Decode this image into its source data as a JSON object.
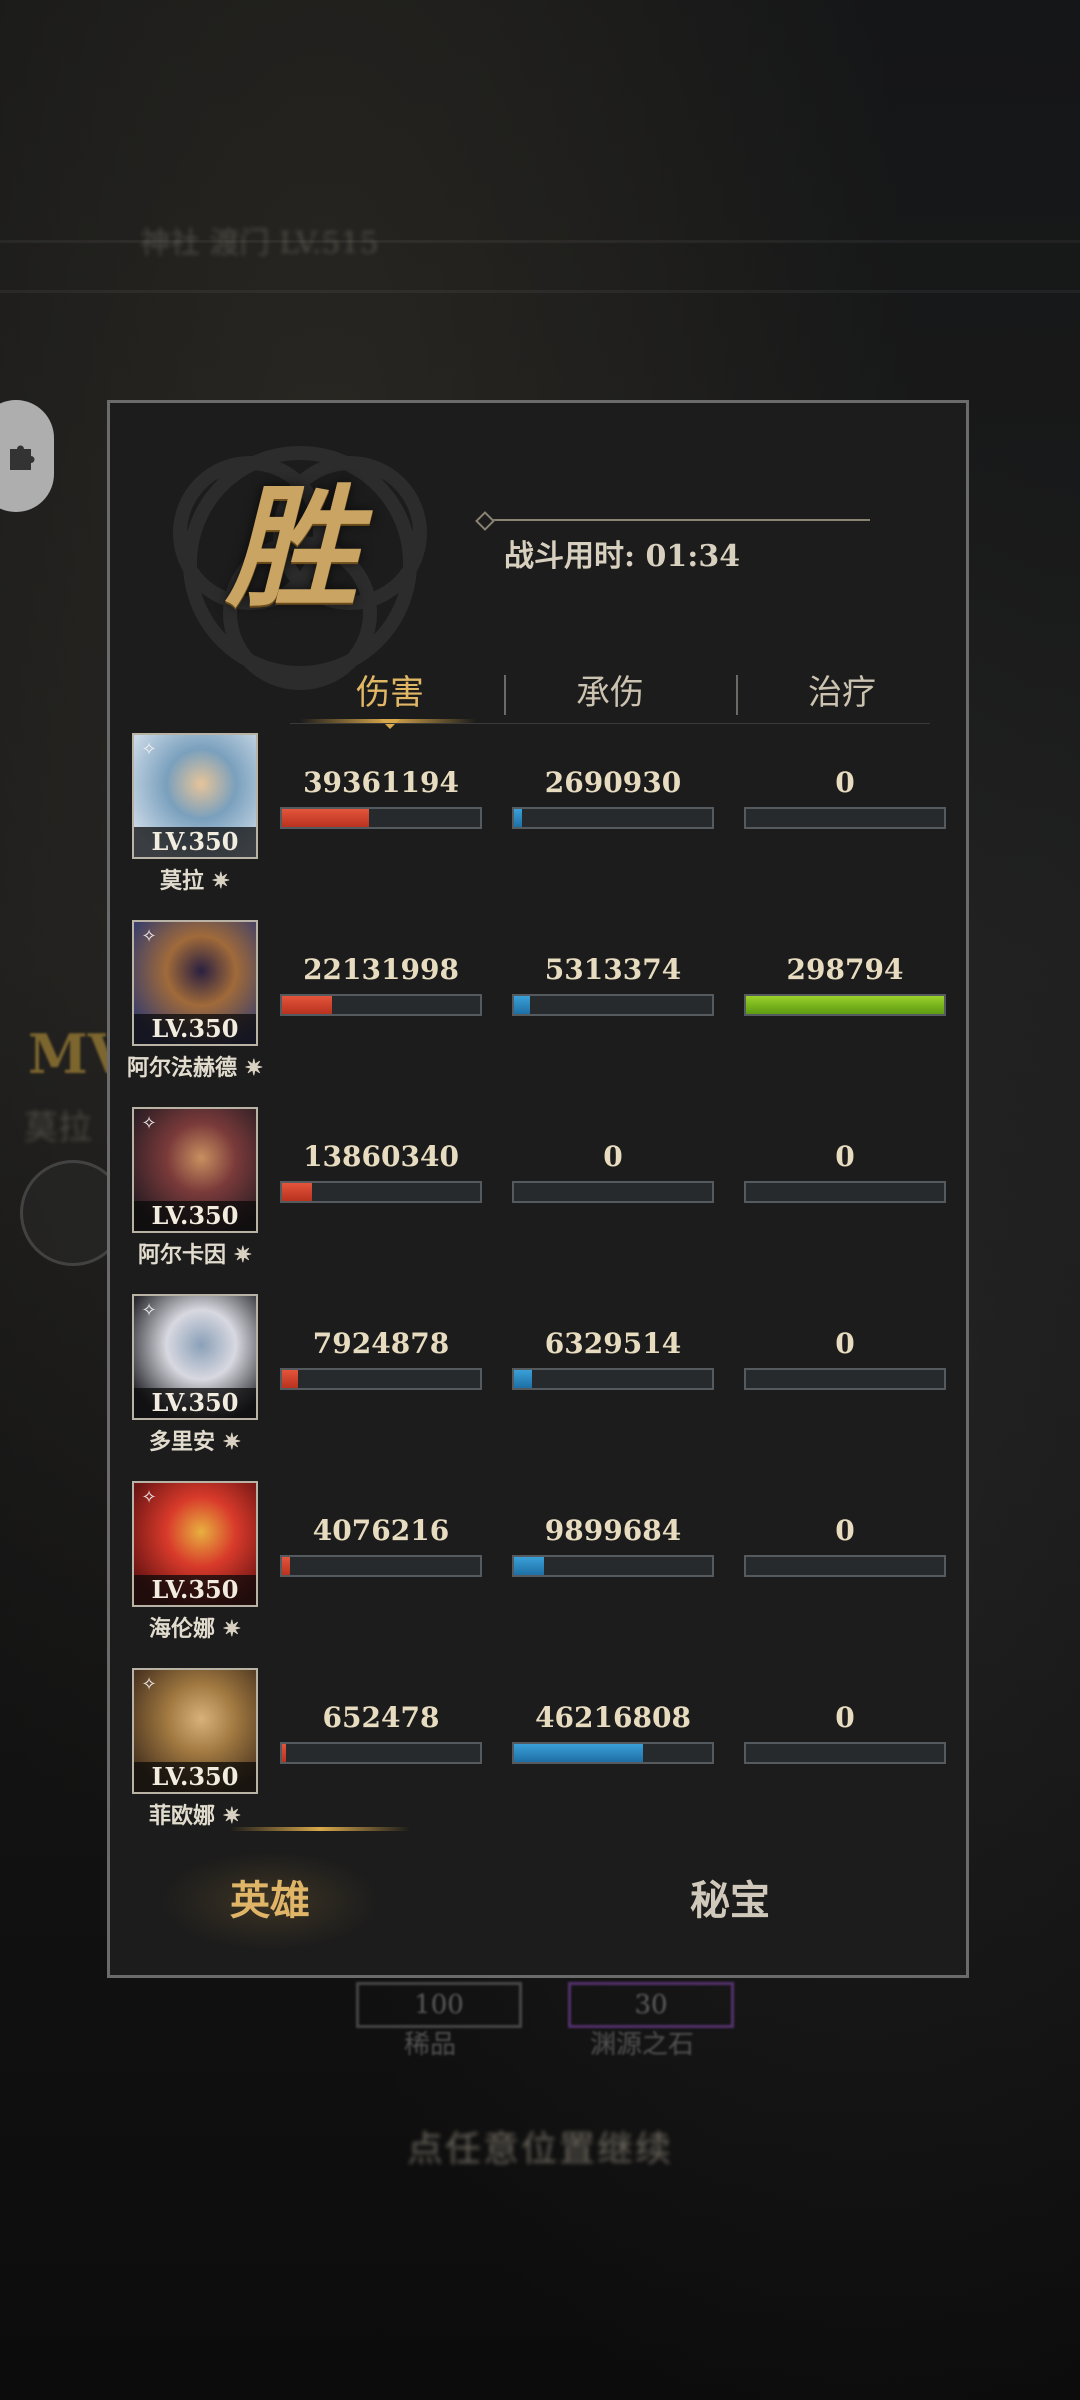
{
  "background": {
    "faded_top_label": "神社 渡门 LV.515",
    "mvp_label": "MV",
    "mvp_sub": "莫拉",
    "cost_items": [
      {
        "value": "100",
        "label": "稀品"
      },
      {
        "value": "30",
        "label": "渊源之石"
      }
    ],
    "continue_hint": "点任意位置继续"
  },
  "result": {
    "title": "胜",
    "time_label": "战斗用时: 01:34"
  },
  "tabs": [
    {
      "label": "伤害",
      "active": true
    },
    {
      "label": "承伤",
      "active": false
    },
    {
      "label": "治疗",
      "active": false
    }
  ],
  "bar_maxima": {
    "damage": 90000000,
    "taken": 90000000,
    "healing": 298794
  },
  "heroes": [
    {
      "name": "莫拉",
      "level": "LV.350",
      "damage": "39361194",
      "taken": "2690930",
      "healing": "0",
      "damage_fraction": 0.44,
      "taken_fraction": 0.04,
      "healing_fraction": 0.0,
      "portrait_colors": [
        "#c9d8e6",
        "#7aa0bd",
        "#e6c49a"
      ]
    },
    {
      "name": "阿尔法赫德",
      "level": "LV.350",
      "damage": "22131998",
      "taken": "5313374",
      "healing": "298794",
      "damage_fraction": 0.25,
      "taken_fraction": 0.08,
      "healing_fraction": 1.0,
      "portrait_colors": [
        "#3b3f6a",
        "#a06a3a",
        "#2a2040"
      ]
    },
    {
      "name": "阿尔卡因",
      "level": "LV.350",
      "damage": "13860340",
      "taken": "0",
      "healing": "0",
      "damage_fraction": 0.15,
      "taken_fraction": 0.0,
      "healing_fraction": 0.0,
      "portrait_colors": [
        "#2b1e24",
        "#7a3a3a",
        "#c89060"
      ]
    },
    {
      "name": "多里安",
      "level": "LV.350",
      "damage": "7924878",
      "taken": "6329514",
      "healing": "0",
      "damage_fraction": 0.08,
      "taken_fraction": 0.09,
      "healing_fraction": 0.0,
      "portrait_colors": [
        "#2a2a30",
        "#d8d8e0",
        "#8aa0b8"
      ]
    },
    {
      "name": "海伦娜",
      "level": "LV.350",
      "damage": "4076216",
      "taken": "9899684",
      "healing": "0",
      "damage_fraction": 0.04,
      "taken_fraction": 0.15,
      "healing_fraction": 0.0,
      "portrait_colors": [
        "#6a1414",
        "#d83a2a",
        "#e8b040"
      ]
    },
    {
      "name": "菲欧娜",
      "level": "LV.350",
      "damage": "652478",
      "taken": "46216808",
      "healing": "0",
      "damage_fraction": 0.01,
      "taken_fraction": 0.65,
      "healing_fraction": 0.0,
      "portrait_colors": [
        "#4a3420",
        "#a07840",
        "#d8b07a"
      ]
    }
  ],
  "bottom_tabs": {
    "heroes": "英雄",
    "treasures": "秘宝"
  }
}
